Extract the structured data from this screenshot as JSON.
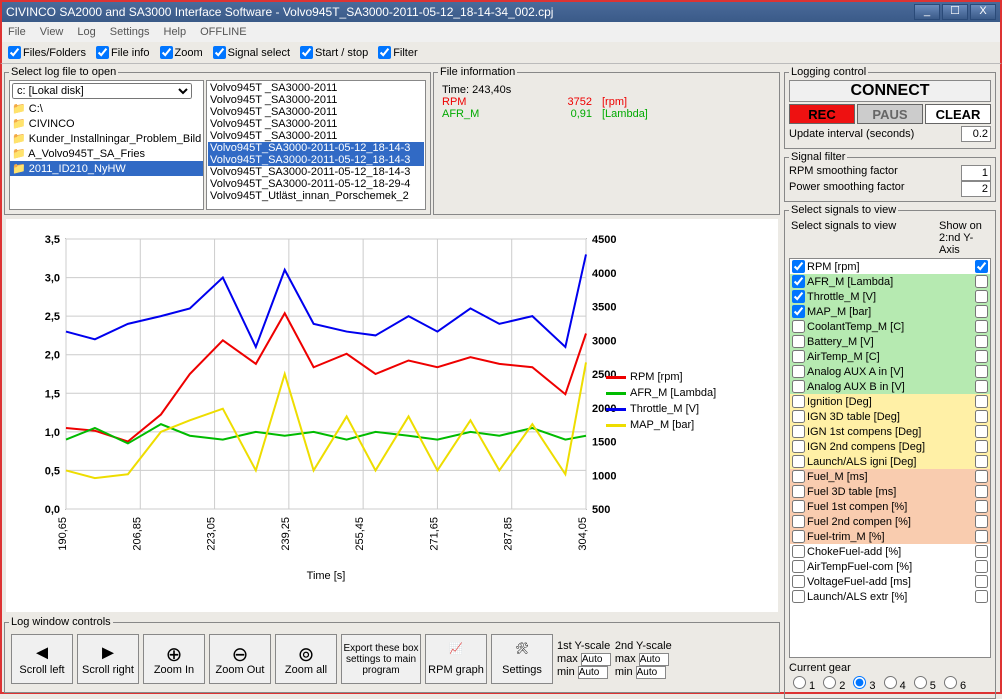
{
  "window": {
    "title": "CIVINCO SA2000 and SA3000 Interface Software - Volvo945T_SA3000-2011-05-12_18-14-34_002.cpj",
    "min": "_",
    "max": "☐",
    "close": "X"
  },
  "menu": [
    "File",
    "View",
    "Log",
    "Settings",
    "Help",
    "OFFLINE"
  ],
  "toolbar": [
    {
      "label": "Files/Folders",
      "checked": true
    },
    {
      "label": "File info",
      "checked": true
    },
    {
      "label": "Zoom",
      "checked": true
    },
    {
      "label": "Signal select",
      "checked": true
    },
    {
      "label": "Start / stop",
      "checked": true
    },
    {
      "label": "Filter",
      "checked": true
    }
  ],
  "fileselect": {
    "legend": "Select log file to open",
    "drive": "c: [Lokal disk]",
    "folders": [
      {
        "name": "C:\\",
        "sel": false
      },
      {
        "name": "CIVINCO",
        "sel": false
      },
      {
        "name": "Kunder_Installningar_Problem_Bild",
        "sel": false
      },
      {
        "name": "A_Volvo945T_SA_Fries",
        "sel": false
      },
      {
        "name": "2011_ID210_NyHW",
        "sel": true
      }
    ],
    "files": [
      {
        "name": "Volvo945T                         _SA3000-2011",
        "sel": false
      },
      {
        "name": "Volvo945T                         _SA3000-2011",
        "sel": false
      },
      {
        "name": "Volvo945T                         _SA3000-2011",
        "sel": false
      },
      {
        "name": "Volvo945T                         _SA3000-2011",
        "sel": false
      },
      {
        "name": "Volvo945T                         _SA3000-2011",
        "sel": false
      },
      {
        "name": "Volvo945T_SA3000-2011-05-12_18-14-3",
        "sel": true
      },
      {
        "name": "Volvo945T_SA3000-2011-05-12_18-14-3",
        "sel": true
      },
      {
        "name": "Volvo945T_SA3000-2011-05-12_18-14-3",
        "sel": false
      },
      {
        "name": "Volvo945T_SA3000-2011-05-12_18-29-4",
        "sel": false
      },
      {
        "name": "Volvo945T_Utläst_innan_Porschemek_2",
        "sel": false
      }
    ]
  },
  "fileinfo": {
    "legend": "File information",
    "rows": [
      {
        "label": "Time: 243,40s",
        "value": "",
        "unit": "",
        "color": "#000"
      },
      {
        "label": "RPM",
        "value": "3752",
        "unit": "[rpm]",
        "color": "#e00"
      },
      {
        "label": "AFR_M",
        "value": "0,91",
        "unit": "[Lambda]",
        "color": "#0a0"
      }
    ]
  },
  "logging": {
    "legend": "Logging control",
    "connect": "CONNECT",
    "rec": "REC",
    "paus": "PAUS",
    "clear": "CLEAR",
    "update_label": "Update interval (seconds)",
    "update_val": "0.2"
  },
  "sigfilter": {
    "legend": "Signal filter",
    "rpm_label": "RPM smoothing factor",
    "rpm_val": "1",
    "pow_label": "Power smoothing factor",
    "pow_val": "2"
  },
  "sigselect": {
    "legend": "Select signals to view",
    "head1": "Select signals to view",
    "head2": "Show on 2:nd Y-Axis",
    "items": [
      {
        "label": "RPM [rpm]",
        "c1": true,
        "c2": true,
        "cls": ""
      },
      {
        "label": "AFR_M [Lambda]",
        "c1": true,
        "c2": false,
        "cls": "g-green"
      },
      {
        "label": "Throttle_M [V]",
        "c1": true,
        "c2": false,
        "cls": "g-green"
      },
      {
        "label": "MAP_M [bar]",
        "c1": true,
        "c2": false,
        "cls": "g-green"
      },
      {
        "label": "CoolantTemp_M [C]",
        "c1": false,
        "c2": false,
        "cls": "g-green"
      },
      {
        "label": "Battery_M [V]",
        "c1": false,
        "c2": false,
        "cls": "g-green"
      },
      {
        "label": "AirTemp_M [C]",
        "c1": false,
        "c2": false,
        "cls": "g-green"
      },
      {
        "label": "Analog AUX A in [V]",
        "c1": false,
        "c2": false,
        "cls": "g-green"
      },
      {
        "label": "Analog AUX B in [V]",
        "c1": false,
        "c2": false,
        "cls": "g-green"
      },
      {
        "label": "Ignition [Deg]",
        "c1": false,
        "c2": false,
        "cls": "g-yellow"
      },
      {
        "label": "IGN 3D table [Deg]",
        "c1": false,
        "c2": false,
        "cls": "g-yellow"
      },
      {
        "label": "IGN 1st compens [Deg]",
        "c1": false,
        "c2": false,
        "cls": "g-yellow"
      },
      {
        "label": "IGN 2nd compens [Deg]",
        "c1": false,
        "c2": false,
        "cls": "g-yellow"
      },
      {
        "label": "Launch/ALS igni [Deg]",
        "c1": false,
        "c2": false,
        "cls": "g-yellow"
      },
      {
        "label": "Fuel_M [ms]",
        "c1": false,
        "c2": false,
        "cls": "g-orange"
      },
      {
        "label": "Fuel 3D table [ms]",
        "c1": false,
        "c2": false,
        "cls": "g-orange"
      },
      {
        "label": "Fuel 1st compen [%]",
        "c1": false,
        "c2": false,
        "cls": "g-orange"
      },
      {
        "label": "Fuel 2nd compen [%]",
        "c1": false,
        "c2": false,
        "cls": "g-orange"
      },
      {
        "label": "Fuel-trim_M [%]",
        "c1": false,
        "c2": false,
        "cls": "g-orange"
      },
      {
        "label": "ChokeFuel-add [%]",
        "c1": false,
        "c2": false,
        "cls": ""
      },
      {
        "label": "AirTempFuel-com [%]",
        "c1": false,
        "c2": false,
        "cls": ""
      },
      {
        "label": "VoltageFuel-add [ms]",
        "c1": false,
        "c2": false,
        "cls": ""
      },
      {
        "label": "Launch/ALS extr [%]",
        "c1": false,
        "c2": false,
        "cls": ""
      }
    ]
  },
  "gear": {
    "label": "Current gear",
    "items": [
      "1",
      "2",
      "3",
      "4",
      "5",
      "6"
    ],
    "sel": 2
  },
  "bottom": {
    "legend": "Log window controls",
    "btns": [
      "Scroll left",
      "Scroll right",
      "Zoom In",
      "Zoom Out",
      "Zoom all"
    ],
    "export": "Export these box settings to main program",
    "rpmgraph": "RPM graph",
    "settings": "Settings",
    "y1": "1st Y-scale",
    "y2": "2nd Y-scale",
    "max": "max",
    "min": "min",
    "auto": "Auto"
  },
  "legend_series": [
    {
      "name": "RPM [rpm]",
      "color": "#e00"
    },
    {
      "name": "AFR_M [Lambda]",
      "color": "#0b0"
    },
    {
      "name": "Throttle_M [V]",
      "color": "#00e"
    },
    {
      "name": "MAP_M [bar]",
      "color": "#ed0"
    }
  ],
  "chart_data": {
    "type": "line",
    "xlabel": "Time [s]",
    "x_ticks": [
      "190,65",
      "206,85",
      "223,05",
      "239,25",
      "255,45",
      "271,65",
      "287,85",
      "304,05"
    ],
    "y1_ticks": [
      "0,0",
      "0,5",
      "1,0",
      "1,5",
      "2,0",
      "2,5",
      "3,0",
      "3,5"
    ],
    "y2_ticks": [
      "500",
      "1000",
      "1500",
      "2000",
      "2500",
      "3000",
      "3500",
      "4000",
      "4500"
    ],
    "y1_range": [
      0,
      3.5
    ],
    "y2_range": [
      500,
      4500
    ],
    "series": [
      {
        "name": "RPM [rpm]",
        "axis": "y2",
        "color": "#e00",
        "x": [
          190,
          197,
          205,
          213,
          220,
          228,
          236,
          243,
          250,
          258,
          265,
          273,
          280,
          288,
          295,
          303,
          311,
          316
        ],
        "y": [
          1700,
          1660,
          1500,
          1900,
          2500,
          3000,
          2650,
          3400,
          2600,
          2800,
          2500,
          2700,
          2600,
          2750,
          2650,
          2600,
          2200,
          3100
        ]
      },
      {
        "name": "AFR_M [Lambda]",
        "axis": "y1",
        "color": "#0b0",
        "x": [
          190,
          197,
          205,
          213,
          220,
          228,
          236,
          243,
          250,
          258,
          265,
          273,
          280,
          288,
          295,
          303,
          311,
          316
        ],
        "y": [
          0.9,
          1.05,
          0.85,
          1.1,
          0.95,
          0.9,
          1.0,
          0.95,
          1.0,
          0.9,
          1.0,
          0.95,
          0.9,
          1.0,
          0.95,
          1.05,
          0.9,
          0.95
        ]
      },
      {
        "name": "Throttle_M [V]",
        "axis": "y1",
        "color": "#00e",
        "x": [
          190,
          197,
          205,
          213,
          220,
          228,
          236,
          243,
          250,
          258,
          265,
          273,
          280,
          288,
          295,
          303,
          311,
          316
        ],
        "y": [
          2.3,
          2.2,
          2.4,
          2.5,
          2.6,
          3.0,
          2.1,
          3.1,
          2.4,
          2.3,
          2.25,
          2.5,
          2.3,
          2.6,
          2.4,
          2.5,
          2.1,
          3.3
        ]
      },
      {
        "name": "MAP_M [bar]",
        "axis": "y1",
        "color": "#ed0",
        "x": [
          190,
          197,
          205,
          213,
          220,
          228,
          236,
          243,
          250,
          258,
          265,
          273,
          280,
          288,
          295,
          303,
          311,
          316
        ],
        "y": [
          0.5,
          0.4,
          0.45,
          1.0,
          1.15,
          1.3,
          0.5,
          1.75,
          0.5,
          1.2,
          0.5,
          1.2,
          0.5,
          1.15,
          0.5,
          1.1,
          0.45,
          1.9
        ]
      }
    ]
  }
}
